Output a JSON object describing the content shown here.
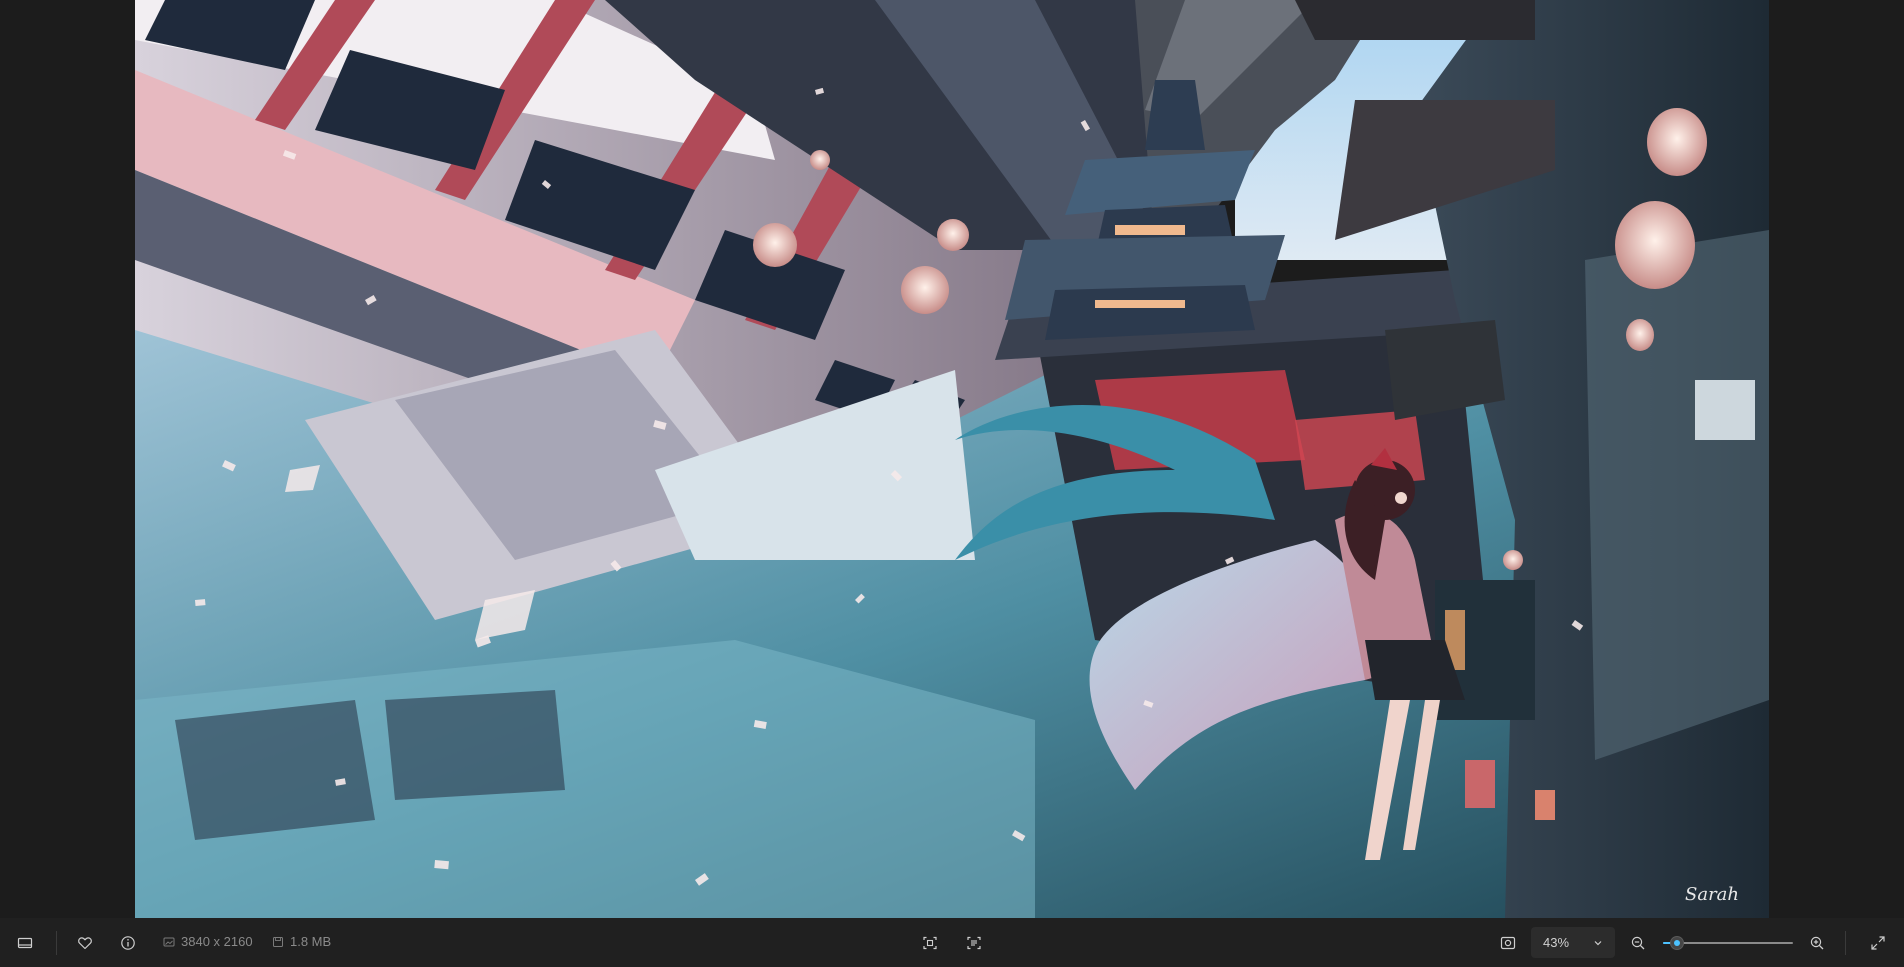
{
  "image": {
    "signature": "Sarah",
    "palette": {
      "sky": "#9cc6e8",
      "water": "#3f7a8c",
      "wood_red": "#a24a55",
      "dark": "#2a2f3a",
      "lantern": "#f0c8c0",
      "hair": "#3a8fa8"
    }
  },
  "toolbar": {
    "filmstrip_icon": "filmstrip-icon",
    "favorite_icon": "heart-icon",
    "info_icon": "info-icon",
    "dimensions": "3840 x 2160",
    "file_size": "1.8 MB",
    "crop_icon": "crop-icon",
    "ocr_icon": "scan-text-icon",
    "fit_icon": "fit-to-window-icon",
    "zoom_value": "43%",
    "zoom_level": 0.08,
    "zoom_out_icon": "zoom-out-icon",
    "zoom_in_icon": "zoom-in-icon",
    "fullscreen_icon": "fullscreen-icon"
  },
  "colors": {
    "accent": "#4cc2ff",
    "toolbar_bg": "#202020",
    "background": "#1c1c1c"
  }
}
